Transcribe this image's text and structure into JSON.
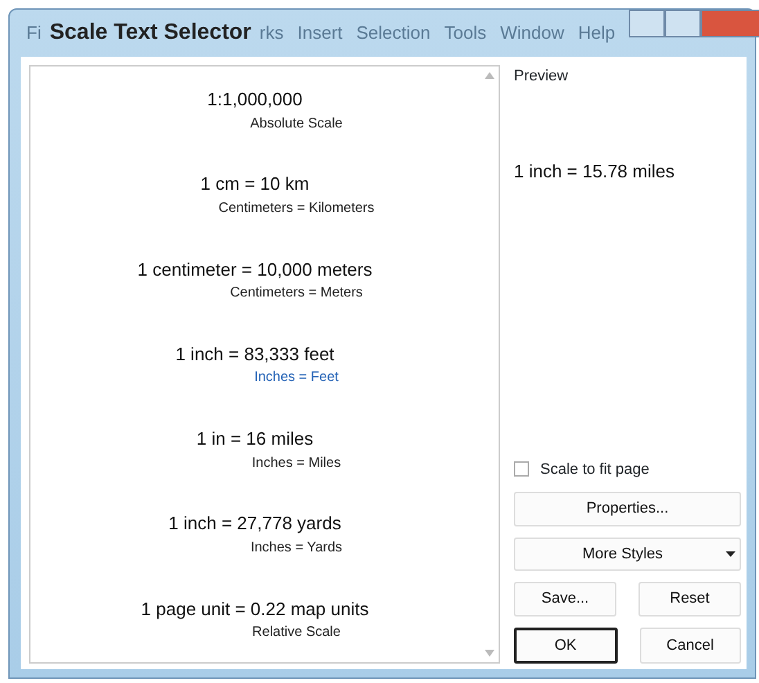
{
  "window": {
    "title": "Scale Text Selector"
  },
  "menu_bar": [
    "Fi",
    "rks",
    "Insert",
    "Selection",
    "Tools",
    "Window",
    "Help"
  ],
  "scale_list": [
    {
      "text": "1:1,000,000",
      "label": "Absolute Scale",
      "selected": false
    },
    {
      "text": "1 cm = 10 km",
      "label": "Centimeters = Kilometers",
      "selected": false
    },
    {
      "text": "1 centimeter = 10,000 meters",
      "label": "Centimeters = Meters",
      "selected": false
    },
    {
      "text": "1 inch = 83,333 feet",
      "label": "Inches = Feet",
      "selected": true
    },
    {
      "text": "1 in = 16 miles",
      "label": "Inches = Miles",
      "selected": false
    },
    {
      "text": "1 inch = 27,778 yards",
      "label": "Inches = Yards",
      "selected": false
    },
    {
      "text": "1 page unit = 0.22 map units",
      "label": "Relative Scale",
      "selected": false
    }
  ],
  "preview": {
    "label": "Preview",
    "text": "1 inch = 15.78 miles"
  },
  "scale_to_fit": {
    "label": "Scale to fit page",
    "checked": false
  },
  "buttons": {
    "properties": "Properties...",
    "more_styles": "More Styles",
    "save": "Save...",
    "reset": "Reset",
    "ok": "OK",
    "cancel": "Cancel"
  }
}
